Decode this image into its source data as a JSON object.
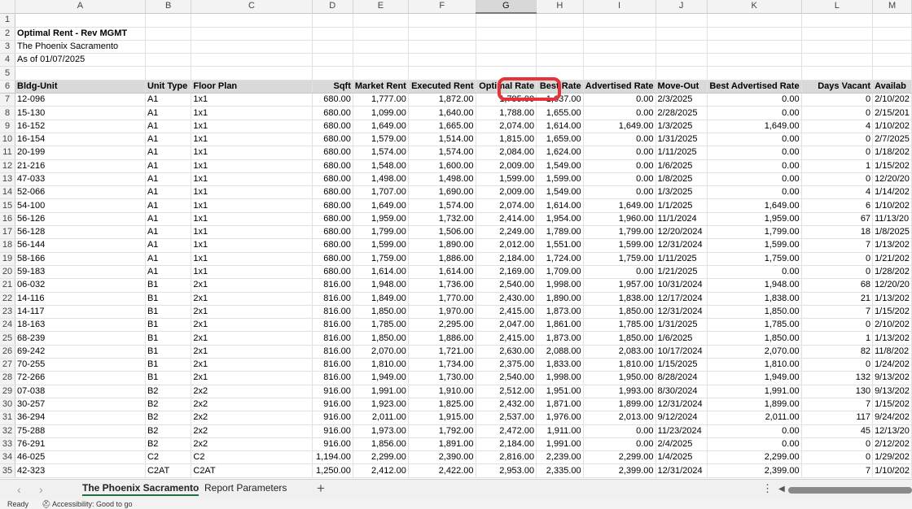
{
  "colors": {
    "highlight": "#e8323a",
    "header_fill": "#d9d9d9",
    "active_tab_underline": "#1e7145"
  },
  "column_letters": [
    "A",
    "B",
    "C",
    "D",
    "E",
    "F",
    "G",
    "H",
    "I",
    "J",
    "K",
    "L",
    "M"
  ],
  "selected_column": "G",
  "row_numbers": [
    1,
    2,
    3,
    4,
    5,
    6,
    7,
    8,
    9,
    10,
    11,
    12,
    13,
    14,
    15,
    16,
    17,
    18,
    19,
    20,
    21,
    22,
    23,
    24,
    25,
    26,
    27,
    28,
    29,
    30,
    31,
    32,
    33,
    34,
    35
  ],
  "report": {
    "title": "Optimal Rent - Rev MGMT",
    "property": "The Phoenix Sacramento",
    "as_of": "As of 01/07/2025"
  },
  "headers": [
    "Bldg-Unit",
    "Unit Type",
    "Floor Plan",
    "Sqft",
    "Market Rent",
    "Executed Rent",
    "Optimal Rate",
    "Best Rate",
    "Advertised Rate",
    "Move-Out",
    "Best Advertised Rate",
    "Days Vacant",
    "Availab"
  ],
  "rows": [
    [
      "12-096",
      "A1",
      "1x1",
      "680.00",
      "1,777.00",
      "1,872.00",
      "1,795.00",
      "1,637.00",
      "0.00",
      "2/3/2025",
      "0.00",
      "0",
      "2/10/202"
    ],
    [
      "15-130",
      "A1",
      "1x1",
      "680.00",
      "1,099.00",
      "1,640.00",
      "1,788.00",
      "1,655.00",
      "0.00",
      "2/28/2025",
      "0.00",
      "0",
      "2/15/201"
    ],
    [
      "16-152",
      "A1",
      "1x1",
      "680.00",
      "1,649.00",
      "1,665.00",
      "2,074.00",
      "1,614.00",
      "1,649.00",
      "1/3/2025",
      "1,649.00",
      "4",
      "1/10/202"
    ],
    [
      "16-154",
      "A1",
      "1x1",
      "680.00",
      "1,579.00",
      "1,514.00",
      "1,815.00",
      "1,659.00",
      "0.00",
      "1/31/2025",
      "0.00",
      "0",
      "2/7/2025"
    ],
    [
      "20-199",
      "A1",
      "1x1",
      "680.00",
      "1,574.00",
      "1,574.00",
      "2,084.00",
      "1,624.00",
      "0.00",
      "1/11/2025",
      "0.00",
      "0",
      "1/18/202"
    ],
    [
      "21-216",
      "A1",
      "1x1",
      "680.00",
      "1,548.00",
      "1,600.00",
      "2,009.00",
      "1,549.00",
      "0.00",
      "1/6/2025",
      "0.00",
      "1",
      "1/15/202"
    ],
    [
      "47-033",
      "A1",
      "1x1",
      "680.00",
      "1,498.00",
      "1,498.00",
      "1,599.00",
      "1,599.00",
      "0.00",
      "1/8/2025",
      "0.00",
      "0",
      "12/20/20"
    ],
    [
      "52-066",
      "A1",
      "1x1",
      "680.00",
      "1,707.00",
      "1,690.00",
      "2,009.00",
      "1,549.00",
      "0.00",
      "1/3/2025",
      "0.00",
      "4",
      "1/14/202"
    ],
    [
      "54-100",
      "A1",
      "1x1",
      "680.00",
      "1,649.00",
      "1,574.00",
      "2,074.00",
      "1,614.00",
      "1,649.00",
      "1/1/2025",
      "1,649.00",
      "6",
      "1/10/202"
    ],
    [
      "56-126",
      "A1",
      "1x1",
      "680.00",
      "1,959.00",
      "1,732.00",
      "2,414.00",
      "1,954.00",
      "1,960.00",
      "11/1/2024",
      "1,959.00",
      "67",
      "11/13/20"
    ],
    [
      "56-128",
      "A1",
      "1x1",
      "680.00",
      "1,799.00",
      "1,506.00",
      "2,249.00",
      "1,789.00",
      "1,799.00",
      "12/20/2024",
      "1,799.00",
      "18",
      "1/8/2025"
    ],
    [
      "56-144",
      "A1",
      "1x1",
      "680.00",
      "1,599.00",
      "1,890.00",
      "2,012.00",
      "1,551.00",
      "1,599.00",
      "12/31/2024",
      "1,599.00",
      "7",
      "1/13/202"
    ],
    [
      "58-166",
      "A1",
      "1x1",
      "680.00",
      "1,759.00",
      "1,886.00",
      "2,184.00",
      "1,724.00",
      "1,759.00",
      "1/11/2025",
      "1,759.00",
      "0",
      "1/21/202"
    ],
    [
      "59-183",
      "A1",
      "1x1",
      "680.00",
      "1,614.00",
      "1,614.00",
      "2,169.00",
      "1,709.00",
      "0.00",
      "1/21/2025",
      "0.00",
      "0",
      "1/28/202"
    ],
    [
      "06-032",
      "B1",
      "2x1",
      "816.00",
      "1,948.00",
      "1,736.00",
      "2,540.00",
      "1,998.00",
      "1,957.00",
      "10/31/2024",
      "1,948.00",
      "68",
      "12/20/20"
    ],
    [
      "14-116",
      "B1",
      "2x1",
      "816.00",
      "1,849.00",
      "1,770.00",
      "2,430.00",
      "1,890.00",
      "1,838.00",
      "12/17/2024",
      "1,838.00",
      "21",
      "1/13/202"
    ],
    [
      "14-117",
      "B1",
      "2x1",
      "816.00",
      "1,850.00",
      "1,970.00",
      "2,415.00",
      "1,873.00",
      "1,850.00",
      "12/31/2024",
      "1,850.00",
      "7",
      "1/15/202"
    ],
    [
      "18-163",
      "B1",
      "2x1",
      "816.00",
      "1,785.00",
      "2,295.00",
      "2,047.00",
      "1,861.00",
      "1,785.00",
      "1/31/2025",
      "1,785.00",
      "0",
      "2/10/202"
    ],
    [
      "68-239",
      "B1",
      "2x1",
      "816.00",
      "1,850.00",
      "1,886.00",
      "2,415.00",
      "1,873.00",
      "1,850.00",
      "1/6/2025",
      "1,850.00",
      "1",
      "1/13/202"
    ],
    [
      "69-242",
      "B1",
      "2x1",
      "816.00",
      "2,070.00",
      "1,721.00",
      "2,630.00",
      "2,088.00",
      "2,083.00",
      "10/17/2024",
      "2,070.00",
      "82",
      "11/8/202"
    ],
    [
      "70-255",
      "B1",
      "2x1",
      "816.00",
      "1,810.00",
      "1,734.00",
      "2,375.00",
      "1,833.00",
      "1,810.00",
      "1/15/2025",
      "1,810.00",
      "0",
      "1/24/202"
    ],
    [
      "72-266",
      "B1",
      "2x1",
      "816.00",
      "1,949.00",
      "1,730.00",
      "2,540.00",
      "1,998.00",
      "1,950.00",
      "8/28/2024",
      "1,949.00",
      "132",
      "9/13/202"
    ],
    [
      "07-038",
      "B2",
      "2x2",
      "916.00",
      "1,991.00",
      "1,910.00",
      "2,512.00",
      "1,951.00",
      "1,993.00",
      "8/30/2024",
      "1,991.00",
      "130",
      "9/13/202"
    ],
    [
      "30-257",
      "B2",
      "2x2",
      "916.00",
      "1,923.00",
      "1,825.00",
      "2,432.00",
      "1,871.00",
      "1,899.00",
      "12/31/2024",
      "1,899.00",
      "7",
      "1/15/202"
    ],
    [
      "36-294",
      "B2",
      "2x2",
      "916.00",
      "2,011.00",
      "1,915.00",
      "2,537.00",
      "1,976.00",
      "2,013.00",
      "9/12/2024",
      "2,011.00",
      "117",
      "9/24/202"
    ],
    [
      "75-288",
      "B2",
      "2x2",
      "916.00",
      "1,973.00",
      "1,792.00",
      "2,472.00",
      "1,911.00",
      "0.00",
      "11/23/2024",
      "0.00",
      "45",
      "12/13/20"
    ],
    [
      "76-291",
      "B2",
      "2x2",
      "916.00",
      "1,856.00",
      "1,891.00",
      "2,184.00",
      "1,991.00",
      "0.00",
      "2/4/2025",
      "0.00",
      "0",
      "2/12/202"
    ],
    [
      "46-025",
      "C2",
      "C2",
      "1,194.00",
      "2,299.00",
      "2,390.00",
      "2,816.00",
      "2,239.00",
      "2,299.00",
      "1/4/2025",
      "2,299.00",
      "0",
      "1/29/202"
    ],
    [
      "42-323",
      "C2AT",
      "C2AT",
      "1,250.00",
      "2,412.00",
      "2,422.00",
      "2,953.00",
      "2,335.00",
      "2,399.00",
      "12/31/2024",
      "2,399.00",
      "7",
      "1/10/202"
    ]
  ],
  "sheet_tabs": [
    {
      "label": "The Phoenix Sacramento",
      "active": true
    },
    {
      "label": "Report Parameters",
      "active": false
    }
  ],
  "icons": {
    "prev": "‹",
    "next": "›",
    "add": "+",
    "more": "⋮",
    "scroll_left": "◀",
    "accessibility": "⛑"
  },
  "status": {
    "mode": "Ready",
    "accessibility": "Accessibility: Good to go"
  }
}
